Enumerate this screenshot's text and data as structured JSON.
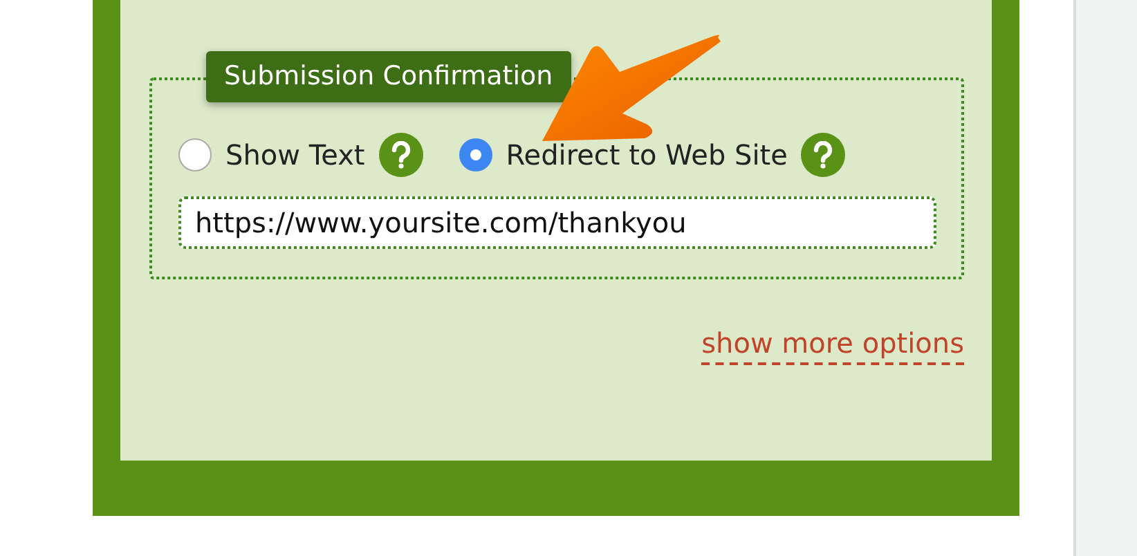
{
  "section": {
    "legend": "Submission Confirmation",
    "options": [
      {
        "label": "Show Text",
        "selected": false
      },
      {
        "label": "Redirect to Web Site",
        "selected": true
      }
    ],
    "url_field": {
      "value": "https://www.yoursite.com/thankyou"
    }
  },
  "link": "show more options"
}
